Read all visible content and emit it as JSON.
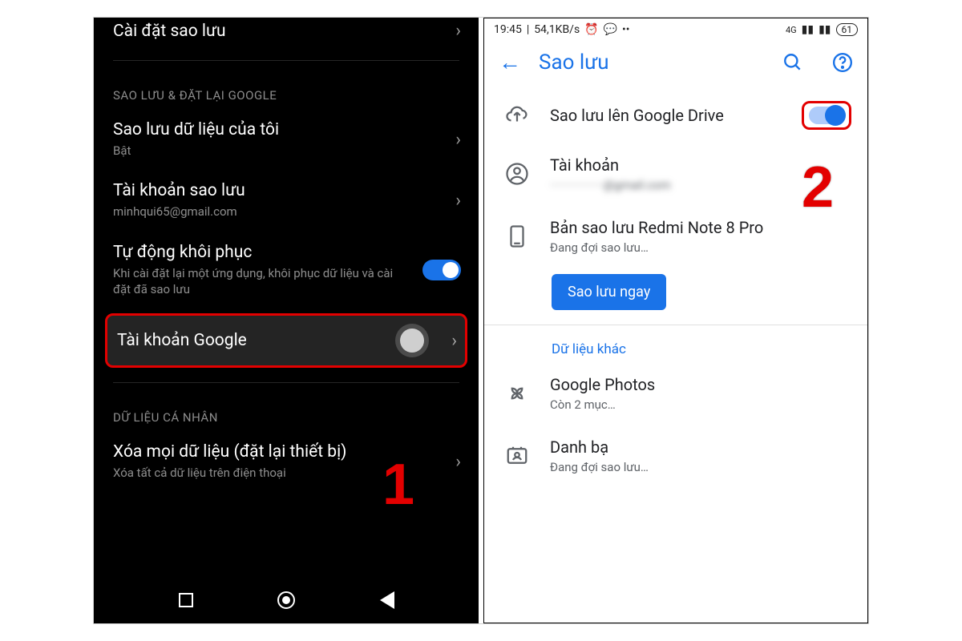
{
  "left": {
    "top_item": {
      "title": "Cài đặt sao lưu"
    },
    "section1": "SAO LƯU & ĐẶT LẠI GOOGLE",
    "backup_my_data": {
      "title": "Sao lưu dữ liệu của tôi",
      "sub": "Bật"
    },
    "backup_account": {
      "title": "Tài khoản sao lưu",
      "sub": "minhqui65@gmail.com"
    },
    "auto_restore": {
      "title": "Tự động khôi phục",
      "sub": "Khi cài đặt lại một ứng dụng, khôi phục dữ liệu và cài đặt đã sao lưu"
    },
    "google_account": {
      "title": "Tài khoản Google"
    },
    "section2": "DỮ LIỆU CÁ NHÂN",
    "factory_reset": {
      "title": "Xóa mọi dữ liệu (đặt lại thiết bị)",
      "sub": "Xóa tất cả dữ liệu trên điện thoại"
    },
    "callout": "1"
  },
  "right": {
    "status": {
      "time": "19:45",
      "speed": "54,1KB/s",
      "battery": "61"
    },
    "appbar": {
      "title": "Sao lưu"
    },
    "drive": {
      "title": "Sao lưu lên Google Drive"
    },
    "account": {
      "title": "Tài khoản",
      "sub": "·················@gmail.com"
    },
    "device": {
      "title": "Bản sao lưu Redmi Note 8 Pro",
      "sub": "Đang đợi sao lưu…"
    },
    "backup_now": "Sao lưu ngay",
    "other_data": "Dữ liệu khác",
    "photos": {
      "title": "Google Photos",
      "sub": "Còn 2 mục…"
    },
    "contacts": {
      "title": "Danh bạ",
      "sub": "Đang đợi sao lưu…"
    },
    "callout": "2"
  }
}
